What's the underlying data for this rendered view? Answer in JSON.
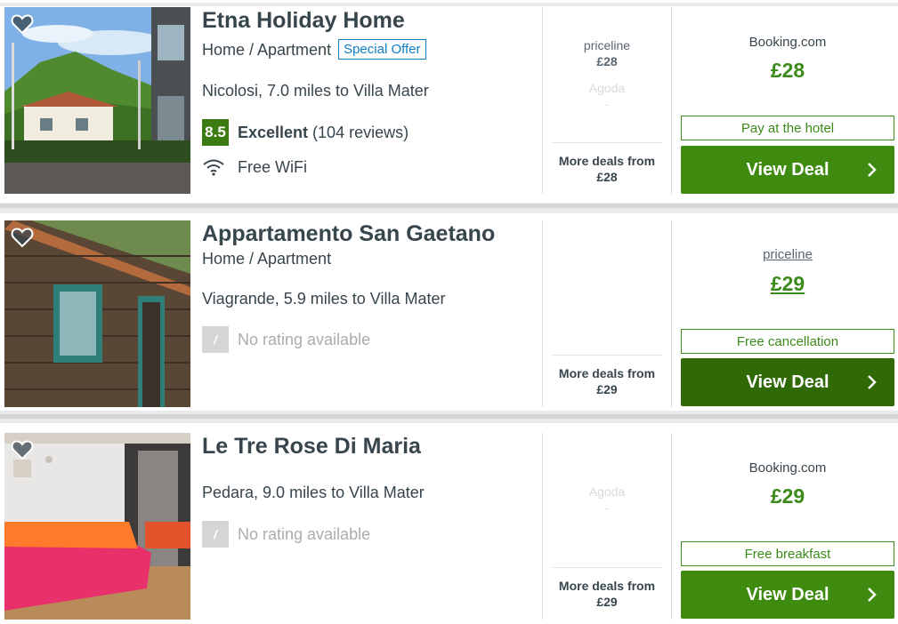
{
  "listings": [
    {
      "title": "Etna Holiday Home",
      "type": "Home / Apartment",
      "badge": "Special Offer",
      "location": "Nicolosi, 7.0 miles to Villa Mater",
      "score": "8.5",
      "rating_label": "Excellent",
      "review_count": "(104 reviews)",
      "amenity": "Free WiFi",
      "amenity_icon": "wifi-icon",
      "alt_deals": [
        {
          "provider": "priceline",
          "price": "£28"
        },
        {
          "provider": "Agoda",
          "price": "-"
        }
      ],
      "more_deals_label": "More deals from",
      "more_deals_price": "£28",
      "provider": "Booking.com",
      "price": "£28",
      "perk": "Pay at the hotel",
      "cta": "View Deal"
    },
    {
      "title": "Appartamento San Gaetano",
      "type": "Home / Apartment",
      "location": "Viagrande, 5.9 miles to Villa Mater",
      "score": "/",
      "rating_none": "No rating available",
      "more_deals_label": "More deals from",
      "more_deals_price": "£29",
      "provider": "priceline",
      "price": "£29",
      "perk": "Free cancellation",
      "cta": "View Deal"
    },
    {
      "title": "Le Tre Rose Di Maria",
      "location": "Pedara, 9.0 miles to Villa Mater",
      "score": "/",
      "rating_none": "No rating available",
      "alt_deals": [
        {
          "provider": "Agoda",
          "price": "-"
        }
      ],
      "more_deals_label": "More deals from",
      "more_deals_price": "£29",
      "provider": "Booking.com",
      "price": "£29",
      "perk": "Free breakfast",
      "cta": "View Deal"
    }
  ],
  "colors": {
    "accent_green": "#3f8b0f",
    "price_green": "#3c8a1a",
    "score_green": "#3c7a12",
    "badge_blue": "#0f7ec6"
  }
}
